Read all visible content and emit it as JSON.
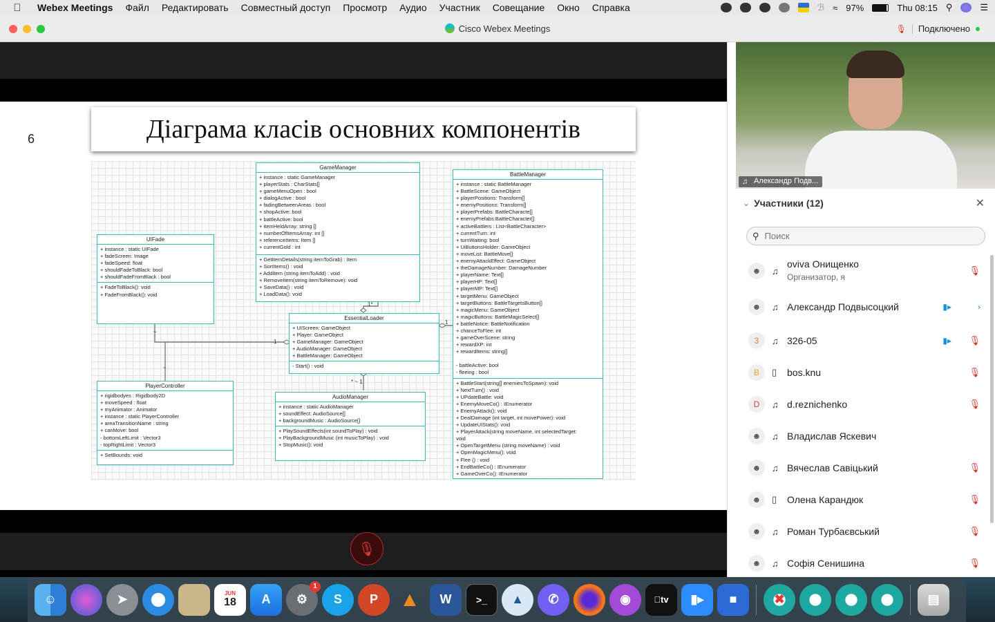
{
  "menubar": {
    "apple": "",
    "app_name": "Webex Meetings",
    "items": [
      "Файл",
      "Редактировать",
      "Совместный доступ",
      "Просмотр",
      "Аудио",
      "Участник",
      "Совещание",
      "Окно",
      "Справка"
    ],
    "battery": "97%",
    "clock": "Thu 08:15"
  },
  "window": {
    "title": "Cisco Webex Meetings",
    "status": "Подключено"
  },
  "slide": {
    "number": "6",
    "title": "Діаграма класів основних компонентів"
  },
  "diagram": {
    "classes": [
      {
        "name": "GameManager",
        "attributes": [
          "+ instance : static GameManager",
          "+ playerStats : CharStats[]",
          "+ gameMenuOpen : bool",
          "+ dialogActive : bool",
          "+ fadingBetweenAreas : bool",
          "+ shopActive: bool",
          "+ battleActive: bool",
          "+ itemHeldArray: string []",
          "+ numberOfItemsArray: int []",
          "+ referenceItems: Item []",
          "+ currentGold : int"
        ],
        "methods": [
          "+ GetItemDetails(string itemToGrab) : Item",
          "+ SortItems() : void",
          "+ AddItem (string itemToAdd) : void",
          "+ RemoveItem(string itemToRemove): void",
          "+ SaveData() : void",
          "+ LoadData(): void"
        ]
      },
      {
        "name": "UIFade",
        "attributes": [
          "+ instance : static UIFade",
          "+ fadeScreen: Image",
          "+ fadeSpeed: float",
          "+ shouldFadeToBlack: bool",
          "+ shouldFadeFromBlack : bool"
        ],
        "methods": [
          "+ FadeToBlack(): void",
          "+ FadeFromBlack(): void"
        ]
      },
      {
        "name": "EssentialLoader",
        "attributes": [
          "+ UIScreen: GameObject",
          "+ Player: GameObject",
          "+ GameManager: GameObject",
          "+ AudioManager: GameObject",
          "+ BattleManager: GameObject"
        ],
        "methods": [
          "- Start() : void"
        ]
      },
      {
        "name": "PlayerController",
        "attributes": [
          "+ rigidbodyes : Rigidbody2D",
          "+ moveSpeed : float",
          "+ myAnimator : Animator",
          "+ instance : static PlayerController",
          "+ areaTransitionName : string",
          "+ canMove: bool",
          "- bottomLeftLimit : Vector3",
          "- topRightLimit : Vector3"
        ],
        "methods": [
          "+ SetBounds: void"
        ]
      },
      {
        "name": "AudioManager",
        "attributes": [
          "+ instance :  static AudioManager",
          "+ soundEffect: AudioSource[]",
          "+ backgroundMusic : AudioSource[]"
        ],
        "methods": [
          "+ PlaySoundEffects(int soundToPlay) : void",
          "+ PlayBackgroundMusic (int musicToPlay) : void",
          "+ StopMusic(): void"
        ]
      },
      {
        "name": "BattleManager",
        "attributes": [
          "+ instance : static BattleManager",
          "+ BattleScene: GameObject",
          "+ playerPositions: Transform[]",
          "+ enemyPositions: Transform[]",
          "+ playerPrefabs: BattleCharacte[]",
          "+ enemyPrefabs:BattleCharacter[]",
          "+ activeBattlers : List<BattleCharacter>",
          "+ currentTurn: int",
          "+ turnWaiting: bool",
          "+ UiButtonsHolder: GameObject",
          "+ moveList: BattleMove[]",
          "+ enemyAttackEffect: GameObject",
          "+ theDamageNumber: DamageNumber",
          "+ playerName: Text[]",
          "+ playerHP: Text[]",
          "+ playerMP: Text[]",
          "+ targetMenu: GameObject",
          "+ targetButtons: BattleTargetsButton[]",
          "+ magicMenu: GameObject",
          "+ magicButtons: BattleMagicSelect[]",
          "+ battleNotice: BattleNotification",
          "+ chanceToFlee: int",
          "+ gameOverScene: string",
          "+ rewardXP: int",
          "+ rewardItems: string[]",
          "",
          "- battleActive: bool",
          "- fleeing : bool"
        ],
        "methods": [
          "+ BattleStart(string[] enemiesToSpawn): void",
          "+ NextTurn() : void",
          "+ UPdateBattle: void",
          "+ EnemyMoveCo() : IEnumerator",
          "+ EnemyAttack(): void",
          "+ DealDamage (int target, int movePower): void",
          "+ UpdateUIStats(): void",
          "+ PlayerAttack(string moveName, int selectedTarget:",
          "void",
          "+ OpenTargetMenu (string moveName) : void",
          "+ OpenMagicMenu(): void",
          "+ Flee () : void",
          "+ EndBattleCo() : IEnumerator",
          "+ GameOverCo(): IEnumerator"
        ]
      }
    ],
    "multiplicity": {
      "m1": "1",
      "m1b": "1*",
      "m2": "1",
      "m3": "1",
      "m4": "* ~ 1",
      "m5": "~",
      "m6": "~"
    }
  },
  "right_panel": {
    "video_label": "Александр Подв...",
    "participants_header": "Участники (12)",
    "search_placeholder": "Поиск",
    "participants": [
      {
        "name": "oviva Онищенко",
        "role": "Организатор, я",
        "avatar": "",
        "device": "headset",
        "muted": true,
        "camera": false
      },
      {
        "name": "Александр Подвысоцкий",
        "role": "",
        "avatar": "",
        "device": "headset",
        "muted": false,
        "camera": true
      },
      {
        "name": "326-05",
        "role": "",
        "avatar": "3",
        "device": "headset",
        "muted": true,
        "camera": true
      },
      {
        "name": "bos.knu",
        "role": "",
        "avatar": "B",
        "device": "phone",
        "muted": true,
        "camera": false
      },
      {
        "name": "d.reznichenko",
        "role": "",
        "avatar": "D",
        "device": "headset",
        "muted": true,
        "camera": false
      },
      {
        "name": "Владислав Яскевич",
        "role": "",
        "avatar": "",
        "device": "headset",
        "muted": false,
        "camera": false
      },
      {
        "name": "Вячеслав Савіцький",
        "role": "",
        "avatar": "",
        "device": "headset",
        "muted": true,
        "camera": false
      },
      {
        "name": "Олена Карандюк",
        "role": "",
        "avatar": "",
        "device": "phone",
        "muted": true,
        "camera": false
      },
      {
        "name": "Роман Турбаєвський",
        "role": "",
        "avatar": "",
        "device": "headset",
        "muted": true,
        "camera": false
      },
      {
        "name": "Софія Сенишина",
        "role": "",
        "avatar": "",
        "device": "headset",
        "muted": true,
        "camera": false
      }
    ]
  },
  "dock": {
    "calendar_month": "JUN",
    "calendar_day": "18",
    "settings_badge": "1",
    "tv_label": "tv"
  },
  "colors": {
    "accent_teal": "#38b8b8",
    "mute_red": "#d93025",
    "camera_blue": "#1a8fd8"
  }
}
